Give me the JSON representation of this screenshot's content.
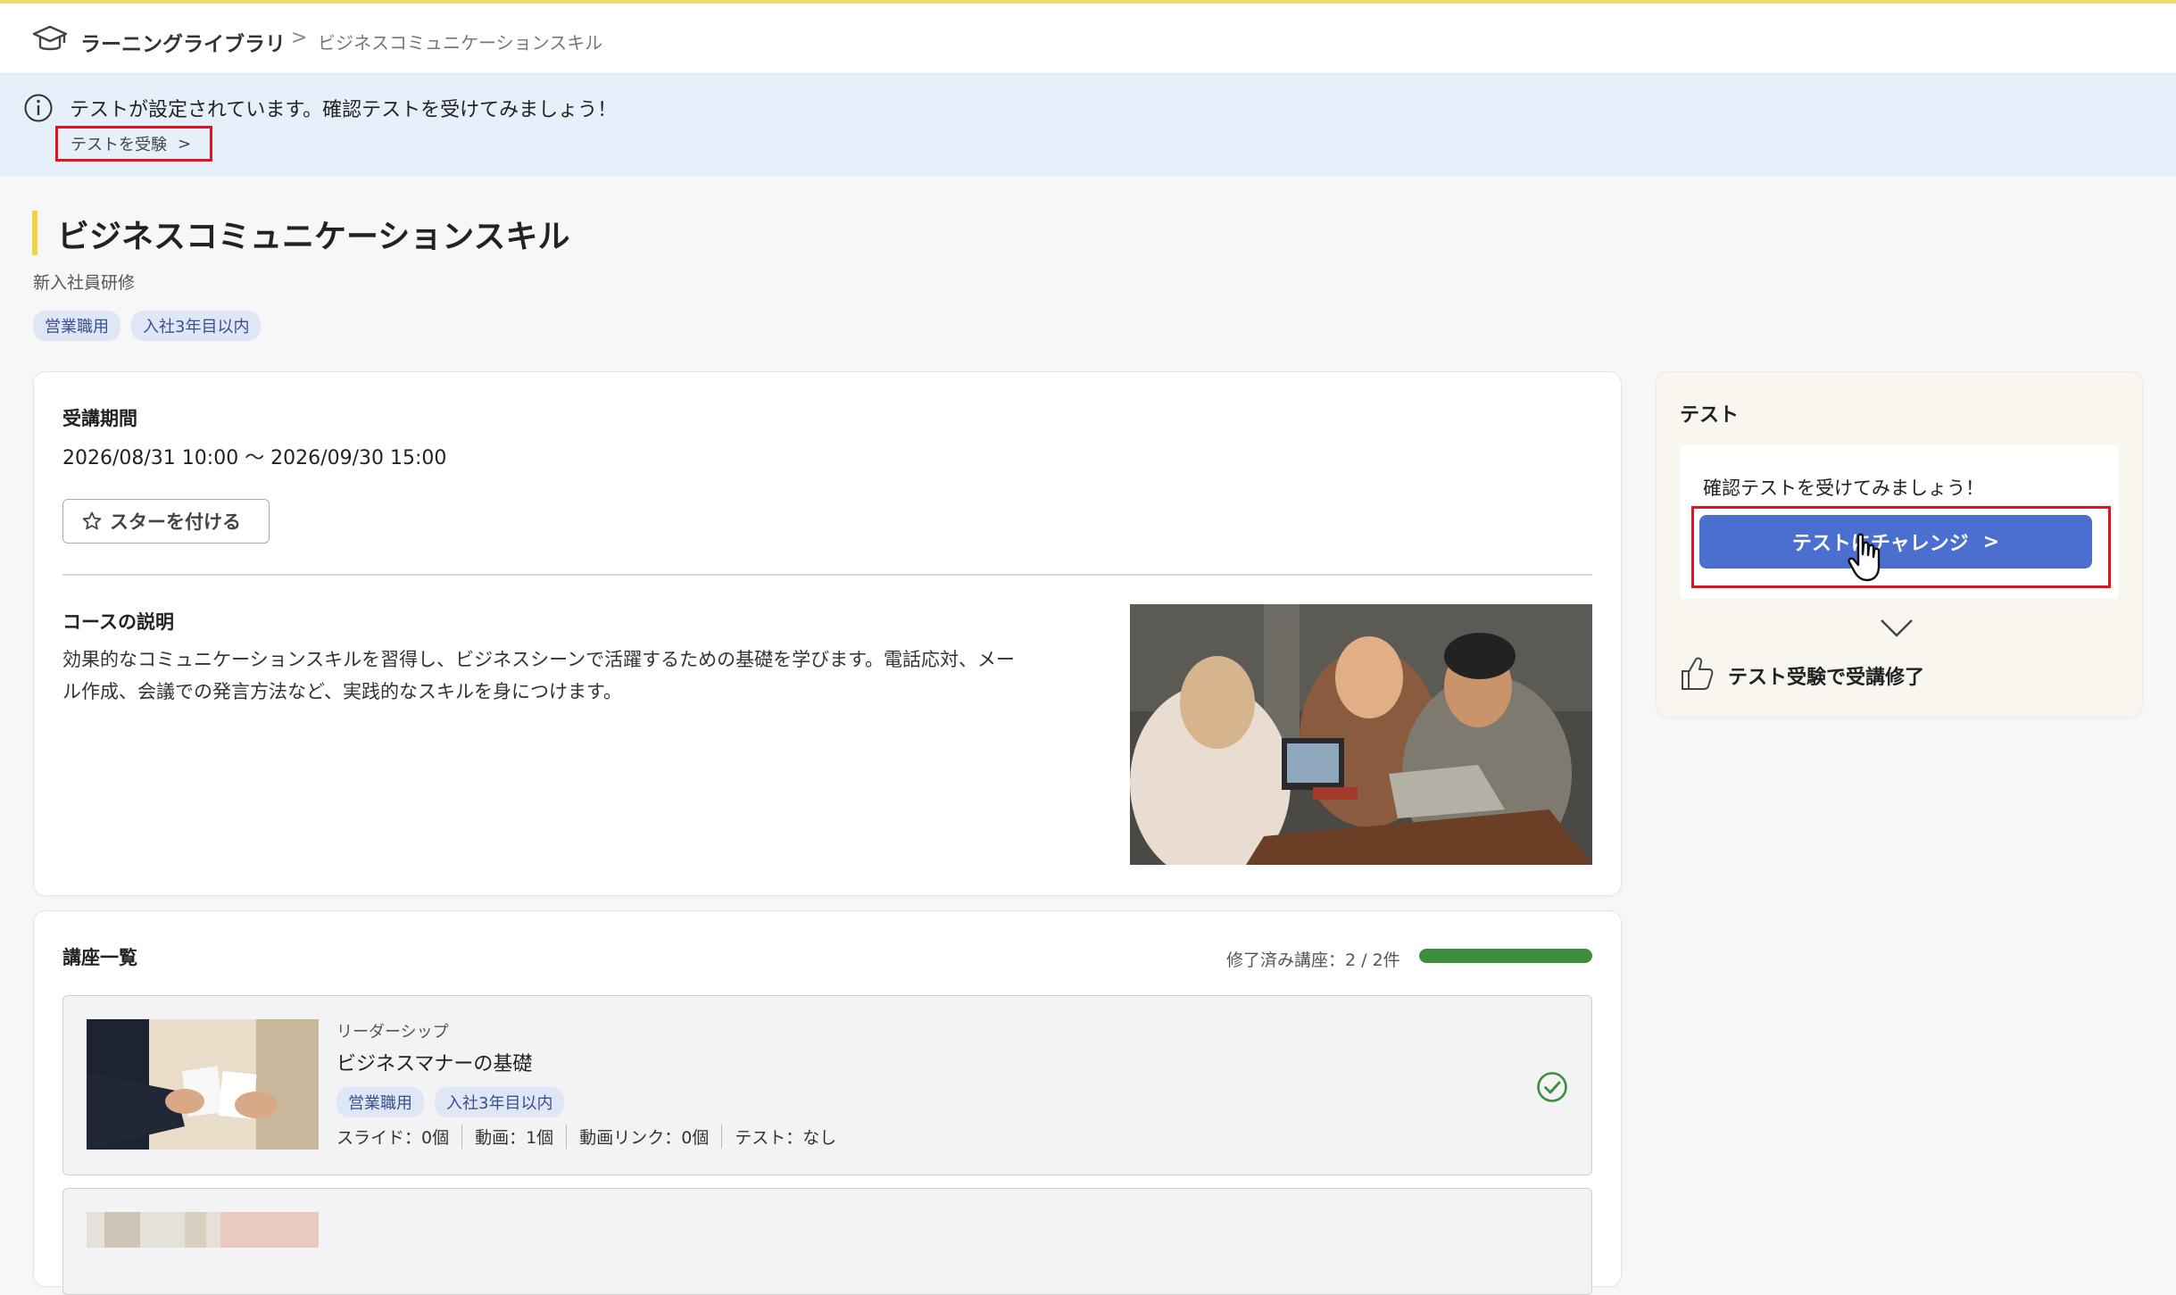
{
  "header": {
    "app_name": "ラーニングライブラリ",
    "separator": ">",
    "breadcrumb_current": "ビジネスコミュニケーションスキル"
  },
  "banner": {
    "message": "テストが設定されています。確認テストを受けてみましょう！",
    "link_label": "テストを受験",
    "link_chevron": ">"
  },
  "course": {
    "title": "ビジネスコミュニケーションスキル",
    "subtitle": "新入社員研修",
    "tags": [
      "営業職用",
      "入社3年目以内"
    ],
    "period_label": "受講期間",
    "period_value": "2026/08/31 10:00 〜 2026/09/30 15:00",
    "star_label": "スターを付ける",
    "description_label": "コースの説明",
    "description_line1": "効果的なコミュニケーションスキルを習得し、ビジネスシーンで活躍するための基礎を学びます。電話応対、メー",
    "description_line2": "ル作成、会議での発言方法など、実践的なスキルを身につけます。"
  },
  "test_panel": {
    "title": "テスト",
    "prompt": "確認テストを受けてみましょう！",
    "button_label": "テストにチャレンジ",
    "button_chevron": ">",
    "completion_text": "テスト受験で受講修了"
  },
  "lessons": {
    "label": "講座一覧",
    "progress_text": "修了済み講座：2 / 2件",
    "progress_fraction": 1.0,
    "items": [
      {
        "category": "リーダーシップ",
        "title": "ビジネスマナーの基礎",
        "tags": [
          "営業職用",
          "入社3年目以内"
        ],
        "meta": [
          "スライド：0個",
          "動画：1個",
          "動画リンク：0個",
          "テスト：なし"
        ],
        "completed": true
      }
    ]
  },
  "colors": {
    "accent_yellow": "#f3d24a",
    "banner_bg": "#e6f0fa",
    "primary_button": "#4a6fcf",
    "highlight_red": "#e0141c",
    "progress_green": "#3c8d3c"
  },
  "icons": [
    "graduation-cap-icon",
    "info-icon",
    "star-icon",
    "chevron-down-icon",
    "thumbs-up-icon",
    "check-circle-icon",
    "hand-cursor-icon"
  ]
}
